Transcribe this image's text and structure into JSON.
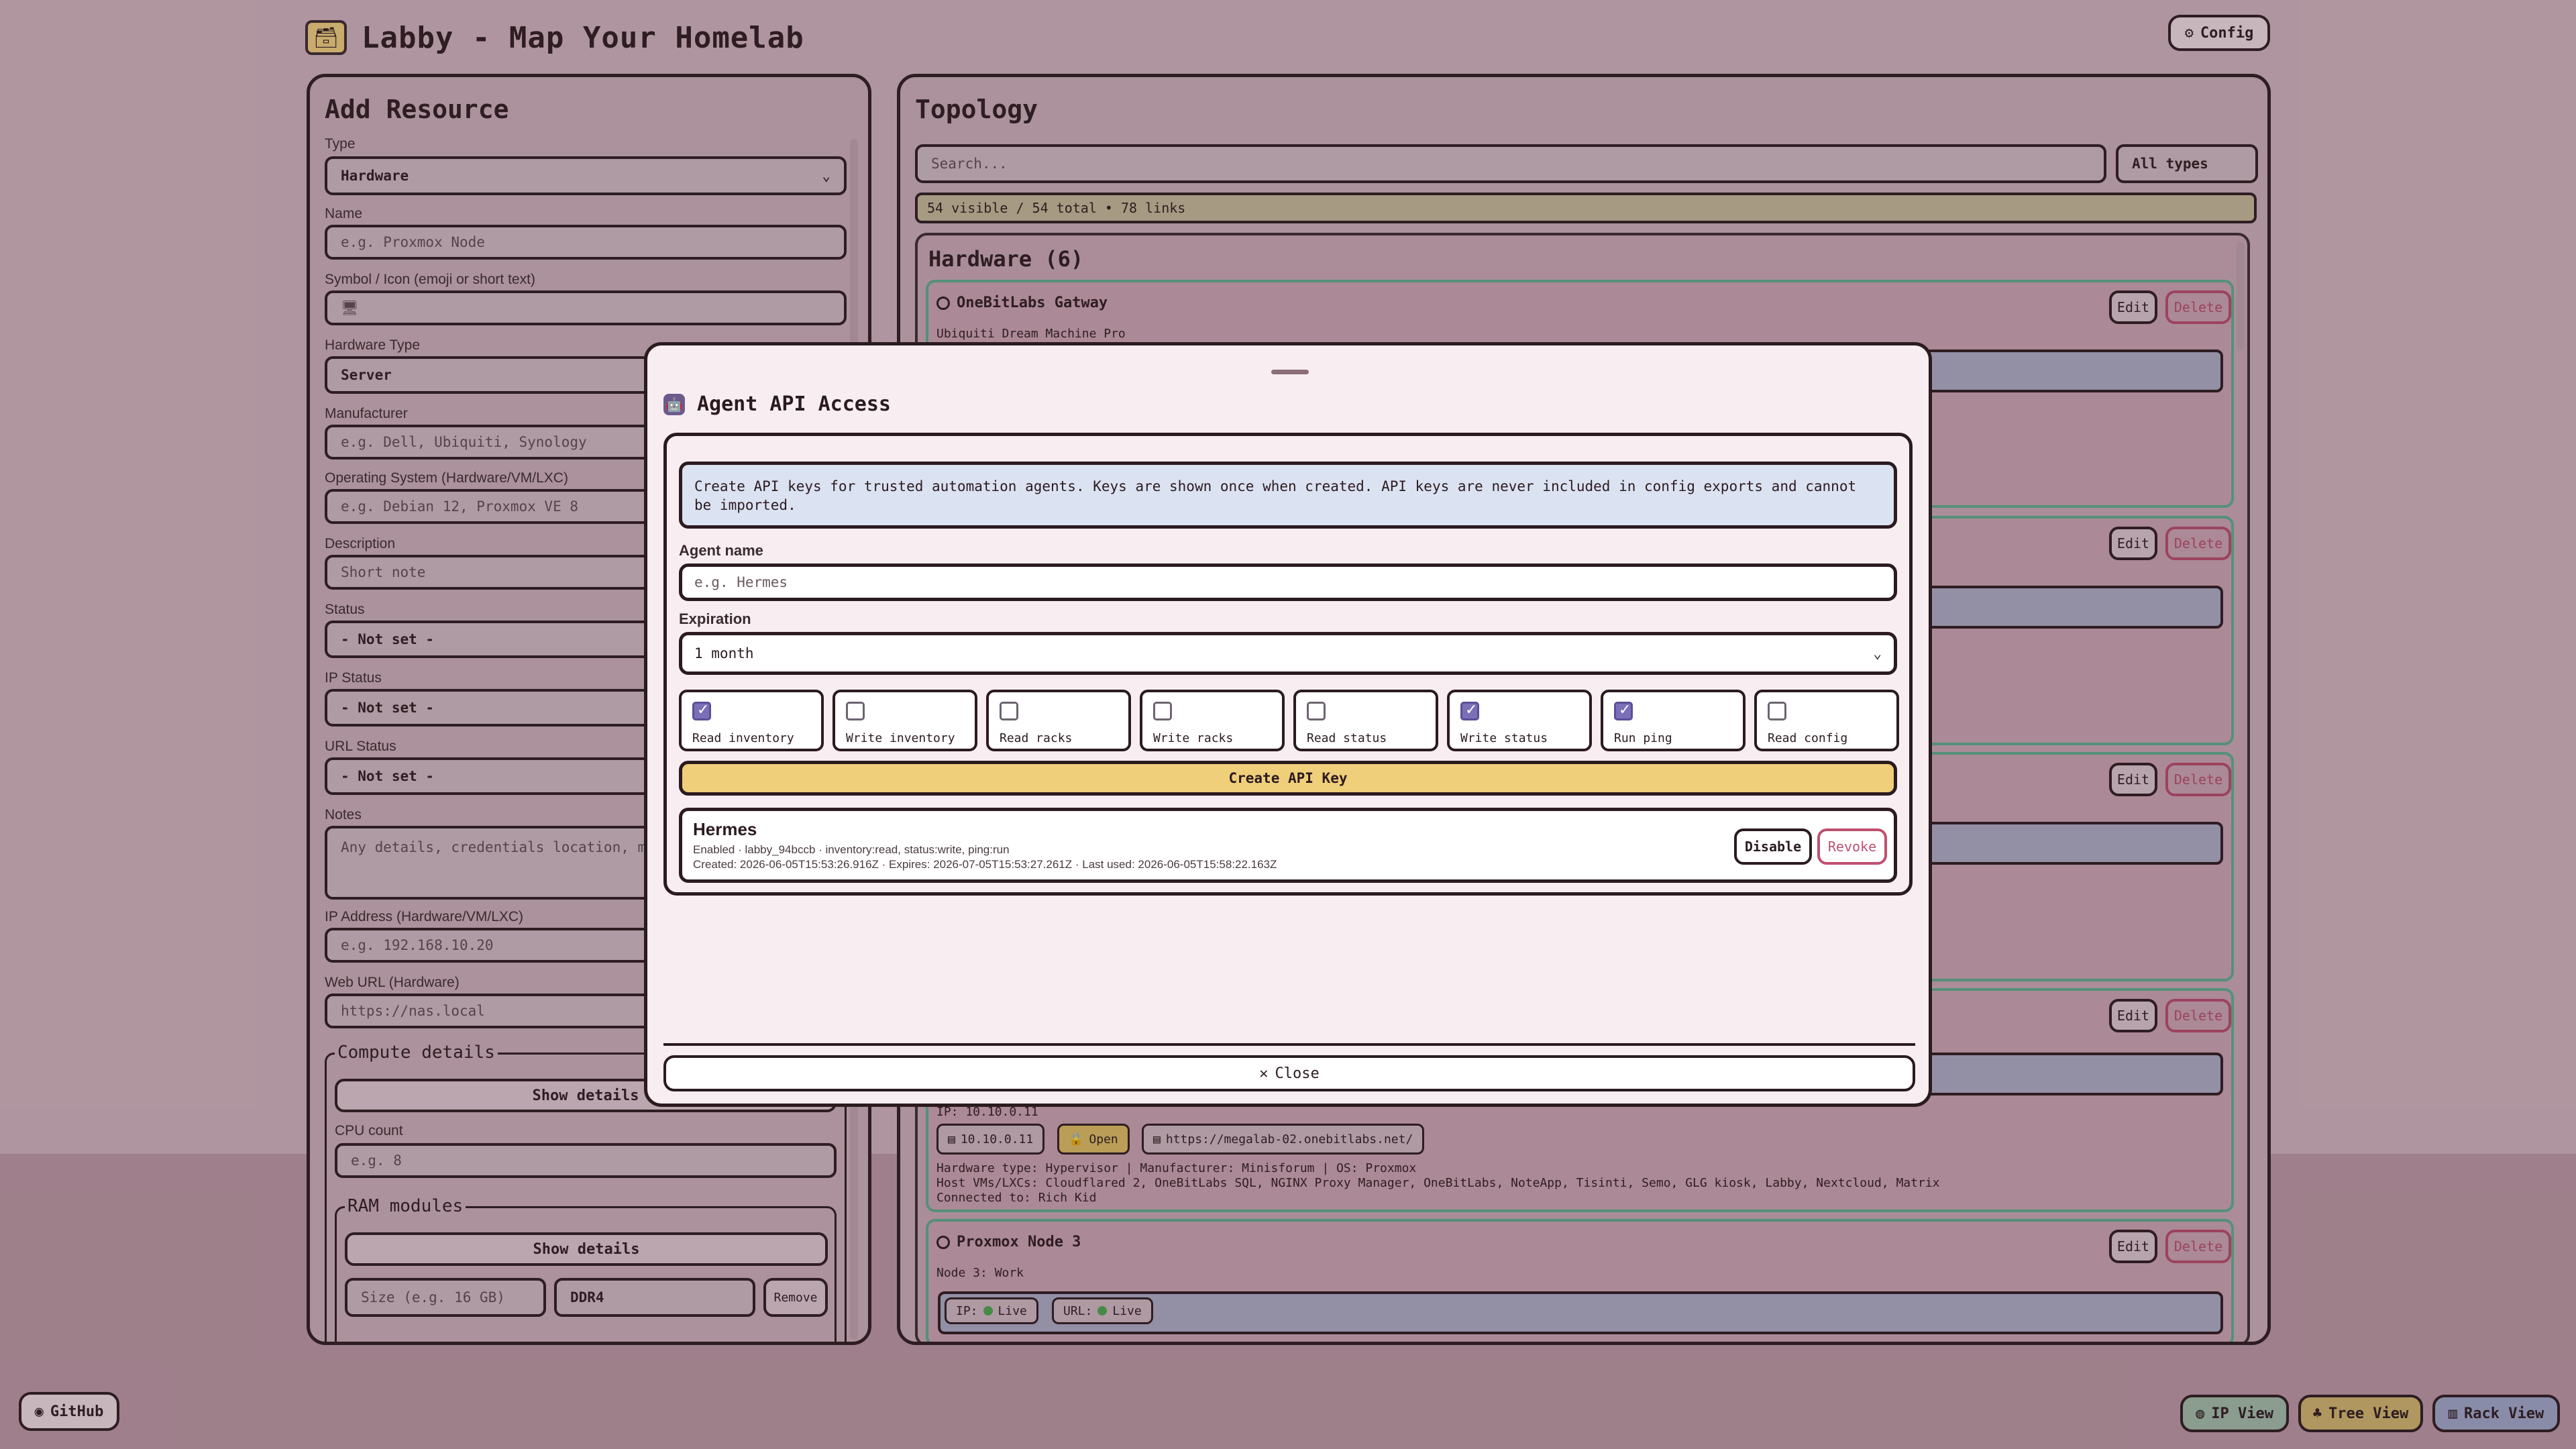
{
  "app": {
    "title": "Labby - Map Your Homelab",
    "logo_icon": "🗃",
    "config_label": "Config",
    "config_icon": "⚙"
  },
  "left": {
    "title": "Add Resource",
    "type_label": "Type",
    "type_value": "Hardware",
    "name_label": "Name",
    "name_placeholder": "e.g. Proxmox Node",
    "symbol_label": "Symbol / Icon (emoji or short text)",
    "symbol_value": "🖥",
    "hwtype_label": "Hardware Type",
    "hwtype_value": "Server",
    "manufacturer_label": "Manufacturer",
    "manufacturer_placeholder": "e.g. Dell, Ubiquiti, Synology",
    "os_label": "Operating System (Hardware/VM/LXC)",
    "os_placeholder": "e.g. Debian 12, Proxmox VE 8",
    "desc_label": "Description",
    "desc_placeholder": "Short note",
    "status_label": "Status",
    "status_value": "- Not set -",
    "ipstatus_label": "IP Status",
    "ipstatus_value": "- Not set -",
    "urlstatus_label": "URL Status",
    "urlstatus_value": "- Not set -",
    "notes_label": "Notes",
    "notes_placeholder": "Any details, credentials location, mai",
    "ip_label": "IP Address (Hardware/VM/LXC)",
    "ip_placeholder": "e.g. 192.168.10.20",
    "url_label": "Web URL (Hardware)",
    "url_placeholder": "https://nas.local",
    "compute_legend": "Compute details",
    "show_details": "Show details",
    "cpu_label": "CPU count",
    "cpu_placeholder": "e.g. 8",
    "ram_legend": "RAM modules",
    "ram_show": "Show details",
    "ram_size_placeholder": "Size (e.g. 16 GB)",
    "ram_type_value": "DDR4",
    "remove_label": "Remove"
  },
  "right": {
    "title": "Topology",
    "search_placeholder": "Search...",
    "filter_value": "All types",
    "count_text": "54 visible / 54 total • 78 links",
    "section_title": "Hardware (6)",
    "edit_label": "Edit",
    "delete_label": "Delete",
    "card1": {
      "name": "OneBitLabs Gatway",
      "sub": "Ubiquiti Dream Machine Pro"
    },
    "card4": {
      "ip_line": "IP: 10.10.0.11",
      "chip_ip": "10.10.0.11",
      "chip_open": "Open",
      "chip_url": "https://megalab-02.onebitlabs.net/",
      "meta1": "Hardware type: Hypervisor | Manufacturer: Minisforum | OS: Proxmox",
      "meta2": "Host VMs/LXCs: Cloudflared 2, OneBitLabs SQL, NGINX Proxy Manager, OneBitLabs, NoteApp, Tisinti, Semo, GLG kiosk, Labby, Nextcloud, Matrix",
      "meta3": "Connected to: Rich Kid"
    },
    "card5": {
      "name": "Proxmox Node 3",
      "sub": "Node 3: Work",
      "ip_chip": "IP:",
      "ip_status": "Live",
      "url_chip": "URL:",
      "url_status": "Live"
    }
  },
  "modal": {
    "title": "Agent API Access",
    "title_icon": "🤖",
    "info": "Create API keys for trusted automation agents. Keys are shown once when created. API keys are never included in config exports and cannot be imported.",
    "agent_label": "Agent name",
    "agent_placeholder": "e.g. Hermes",
    "expiration_label": "Expiration",
    "expiration_value": "1 month",
    "permissions": [
      {
        "label": "Read inventory",
        "checked": true
      },
      {
        "label": "Write inventory",
        "checked": false
      },
      {
        "label": "Read racks",
        "checked": false
      },
      {
        "label": "Write racks",
        "checked": false
      },
      {
        "label": "Read status",
        "checked": false
      },
      {
        "label": "Write status",
        "checked": true
      },
      {
        "label": "Run ping",
        "checked": true
      },
      {
        "label": "Read config",
        "checked": false
      }
    ],
    "create_label": "Create API Key",
    "key": {
      "name": "Hermes",
      "line1": "Enabled · labby_94bccb · inventory:read, status:write, ping:run",
      "line2": "Created: 2026-06-05T15:53:26.916Z · Expires: 2026-07-05T15:53:27.261Z · Last used: 2026-06-05T15:58:22.163Z",
      "disable_label": "Disable",
      "revoke_label": "Revoke"
    },
    "close_label": "Close"
  },
  "footer": {
    "github": "GitHub",
    "ip_view": "IP View",
    "tree_view": "Tree View",
    "rack_view": "Rack View"
  }
}
